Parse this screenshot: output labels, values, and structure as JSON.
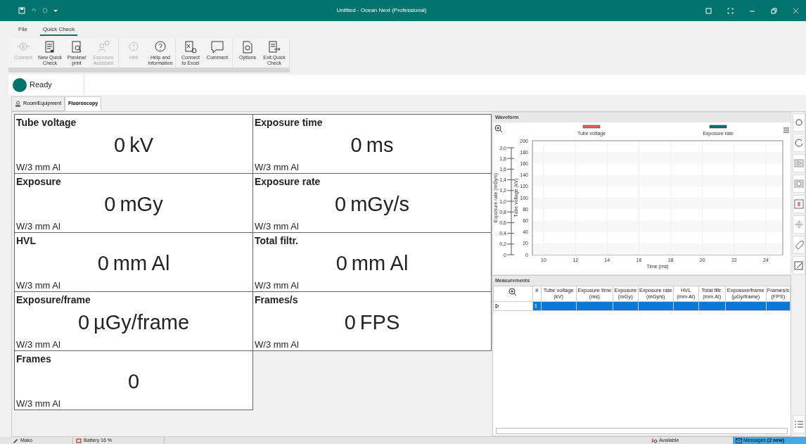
{
  "window": {
    "title": "Untitled - Ocean Next (Professional)"
  },
  "menu_tabs": [
    {
      "label": "File",
      "selected": false
    },
    {
      "label": "Quick Check",
      "selected": true
    }
  ],
  "ribbon_groups": [
    [
      {
        "lines": [
          "Connect"
        ],
        "disabled": true
      },
      {
        "lines": [
          "New Quick",
          "Check"
        ],
        "disabled": false
      },
      {
        "lines": [
          "Preview/",
          "print"
        ],
        "disabled": false
      },
      {
        "lines": [
          "Exposure",
          "Assistant"
        ],
        "disabled": true
      }
    ],
    [
      {
        "lines": [
          "Hint"
        ],
        "disabled": true
      },
      {
        "lines": [
          "Help and",
          "information"
        ],
        "disabled": false
      }
    ],
    [
      {
        "lines": [
          "Connect",
          "to Excel"
        ],
        "disabled": false
      },
      {
        "lines": [
          "Comment"
        ],
        "disabled": false
      }
    ],
    [
      {
        "lines": [
          "Options"
        ],
        "disabled": false
      },
      {
        "lines": [
          "Exit Quick",
          "Check"
        ],
        "disabled": false
      }
    ]
  ],
  "status": {
    "label": "Ready",
    "color": "#00736f"
  },
  "page_tabs": [
    {
      "label": "Room/Equipment",
      "selected": false
    },
    {
      "label": "Fluoroscopy",
      "selected": true
    }
  ],
  "readouts": [
    {
      "title": "Tube voltage",
      "value": "0",
      "unit": "kV",
      "filter": "W/3 mm Al"
    },
    {
      "title": "Exposure time",
      "value": "0",
      "unit": "ms",
      "filter": "W/3 mm Al"
    },
    {
      "title": "Exposure",
      "value": "0",
      "unit": "mGy",
      "filter": "W/3 mm Al"
    },
    {
      "title": "Exposure rate",
      "value": "0",
      "unit": "mGy/s",
      "filter": "W/3 mm Al"
    },
    {
      "title": "HVL",
      "value": "0",
      "unit": "mm Al",
      "filter": "W/3 mm Al"
    },
    {
      "title": "Total filtr.",
      "value": "0",
      "unit": "mm Al",
      "filter": "W/3 mm Al"
    },
    {
      "title": "Exposure/frame",
      "value": "0",
      "unit": "µGy/frame",
      "filter": "W/3 mm Al"
    },
    {
      "title": "Frames/s",
      "value": "0",
      "unit": "FPS",
      "filter": "W/3 mm Al"
    },
    {
      "title": "Frames",
      "value": "0",
      "filter": "W/3 mm Al"
    }
  ],
  "waveform": {
    "title": "Waveform",
    "legend": [
      {
        "label": "Tube voltage",
        "color": "#e8604c"
      },
      {
        "label": "Exposure rate",
        "color": "#00736f"
      }
    ],
    "secondary_axis": {
      "label": "Exposure rate  (mGy/s)",
      "ticks": [
        "2,0",
        "1,8",
        "1,6",
        "1,4",
        "1,2",
        "1,0",
        "0,8",
        "0,6",
        "0,4",
        "0,2",
        "0"
      ]
    },
    "y_axis": {
      "label": "Tube voltage  (kV)",
      "ticks": [
        "200",
        "180",
        "160",
        "140",
        "120",
        "100",
        "80",
        "60",
        "40",
        "20",
        "0"
      ]
    },
    "x_axis": {
      "label": "Time (ms)",
      "ticks": [
        "10",
        "12",
        "14",
        "16",
        "18",
        "20",
        "22",
        "24"
      ]
    }
  },
  "measurements": {
    "title": "Measurements",
    "columns": [
      {
        "label": "#"
      },
      {
        "label": "Tube voltage",
        "unit": "(kV)"
      },
      {
        "label": "Exposure time",
        "unit": "(ms)"
      },
      {
        "label": "Exposure",
        "unit": "(mGy)"
      },
      {
        "label": "Exposure rate",
        "unit": "(mGy/s)"
      },
      {
        "label": "HVL",
        "unit": "(mm Al)"
      },
      {
        "label": "Total filtr.",
        "unit": "(mm Al)"
      },
      {
        "label": "Exposure/frame",
        "unit": "(µGy/frame)"
      },
      {
        "label": "Frames/s",
        "unit": "(FPS)"
      }
    ],
    "rows": [
      {
        "number": "1",
        "selected": true
      }
    ]
  },
  "status_bar": [
    {
      "text": "Mako"
    },
    {
      "text": "Battery 16 %"
    },
    {
      "text": "Available"
    },
    {
      "text": "Messages **(2 new)**"
    }
  ]
}
